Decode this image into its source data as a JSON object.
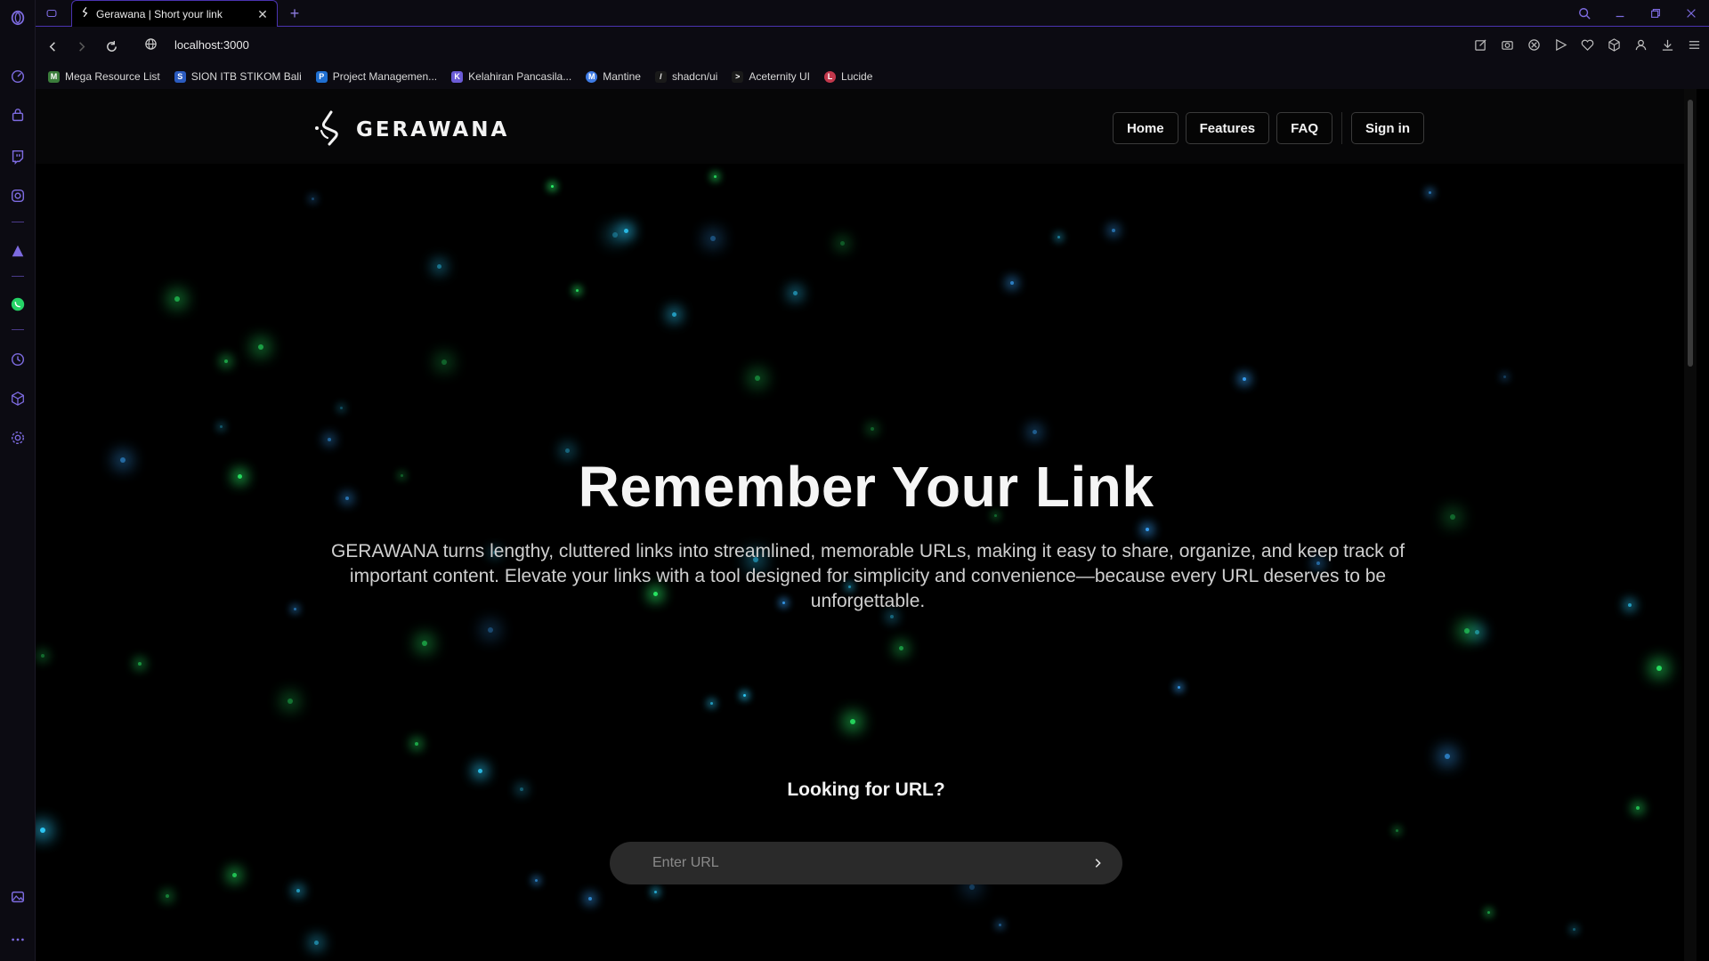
{
  "browser": {
    "tab": {
      "title": "Gerawana | Short your link",
      "close_glyph": "✕"
    },
    "new_tab_glyph": "+",
    "address": {
      "url": "localhost:3000"
    },
    "bookmarks": [
      {
        "label": "Mega Resource List",
        "icon": "mega-resource-icon",
        "color": "#3b7d3b",
        "glyph": "M"
      },
      {
        "label": "SION ITB STIKOM Bali",
        "icon": "sion-icon",
        "color": "#2b5bbf",
        "glyph": "S"
      },
      {
        "label": "Project Managemen...",
        "icon": "trello-icon",
        "color": "#1f6fd1",
        "glyph": "P"
      },
      {
        "label": "Kelahiran Pancasila...",
        "icon": "pancasila-icon",
        "color": "#6b5bd6",
        "glyph": "K"
      },
      {
        "label": "Mantine",
        "icon": "mantine-icon",
        "color": "#3e7be5",
        "glyph": "M"
      },
      {
        "label": "shadcn/ui",
        "icon": "shadcn-icon",
        "color": "#1a1a1a",
        "glyph": "/"
      },
      {
        "label": "Aceternity UI",
        "icon": "aceternity-icon",
        "color": "#1a1a1a",
        "glyph": ">"
      },
      {
        "label": "Lucide",
        "icon": "lucide-icon",
        "color": "#c2384c",
        "glyph": "L"
      }
    ]
  },
  "site": {
    "brand": "GERAWANA",
    "nav": [
      {
        "label": "Home"
      },
      {
        "label": "Features"
      },
      {
        "label": "FAQ"
      }
    ],
    "signin_label": "Sign in",
    "hero": {
      "title": "Remember Your Link",
      "description": "GERAWANA turns lengthy, cluttered links into streamlined, memorable URLs, making it easy to share, organize, and keep track of important content. Elevate your links with a tool designed for simplicity and convenience—because every URL deserves to be unforgettable."
    },
    "lookup": {
      "label": "Looking for URL?",
      "placeholder": "Enter URL"
    }
  },
  "theme": {
    "accent": "#6b4fe0",
    "particle_colors": [
      "#2fd0ff",
      "#2cff6e",
      "#3aa6ff"
    ]
  }
}
